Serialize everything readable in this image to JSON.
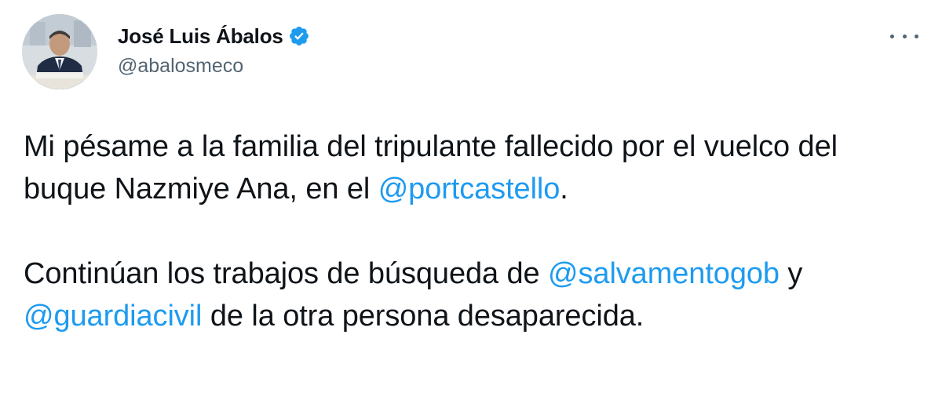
{
  "author": {
    "display_name": "José Luis Ábalos",
    "handle": "@abalosmeco",
    "verified_icon": "verified-badge-icon",
    "accent_color": "#1d9bf0"
  },
  "menu": {
    "icon": "more-options-icon"
  },
  "tweet": {
    "paragraph1": {
      "text1": "Mi pésame a la familia del tripulante fallecido por el vuelco del buque Nazmiye Ana, en el ",
      "mention1": "@portcastello",
      "text2": "."
    },
    "paragraph2": {
      "text1": "Continúan los trabajos de búsqueda de ",
      "mention1": "@salvamentogob",
      "text2": " y ",
      "mention2": "@guardiacivil",
      "text3": " de la otra persona desaparecida."
    }
  }
}
